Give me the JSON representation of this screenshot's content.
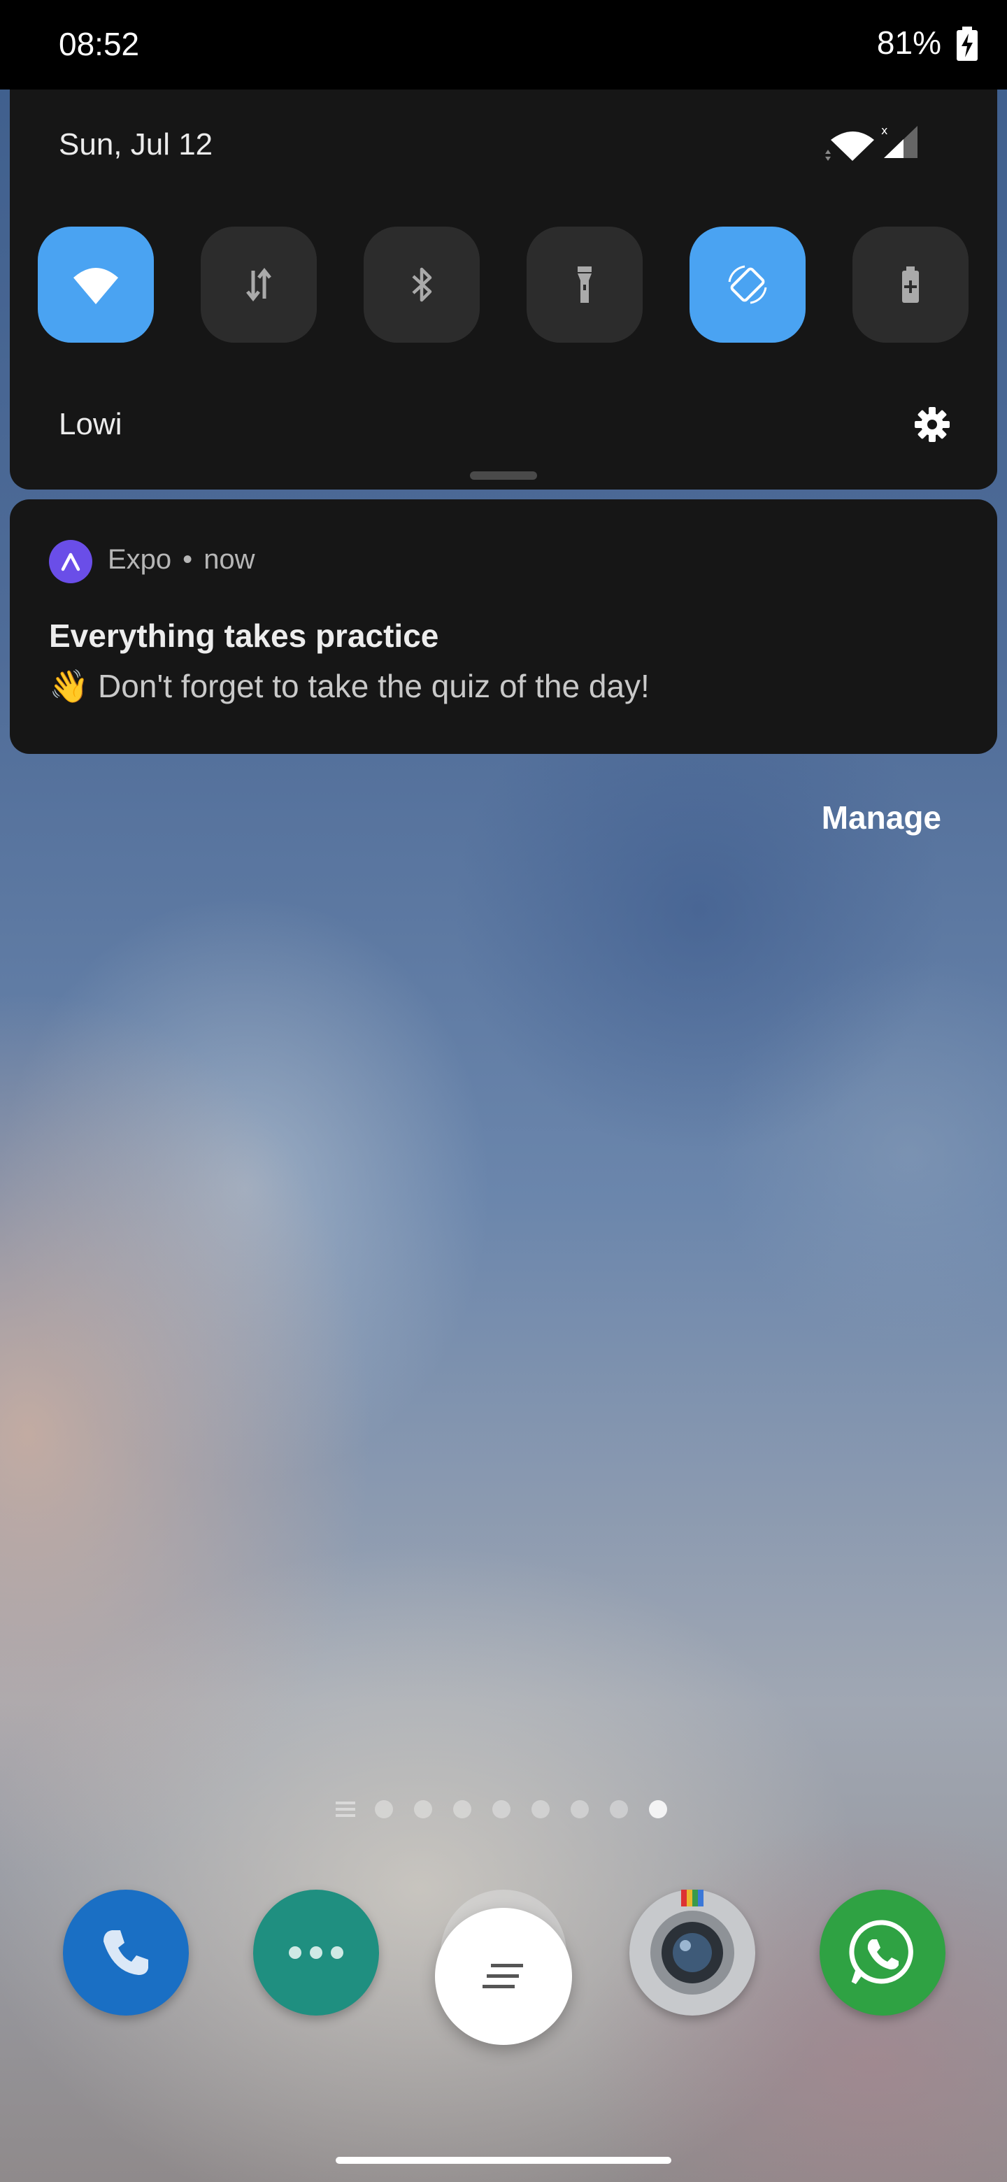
{
  "status_bar": {
    "time": "08:52",
    "battery": "81%"
  },
  "quick_settings": {
    "date": "Sun, Jul 12",
    "carrier": "Lowi",
    "tiles": [
      {
        "name": "wifi",
        "icon": "wifi-icon",
        "active": true
      },
      {
        "name": "mobile-data",
        "icon": "data-arrows-icon",
        "active": false
      },
      {
        "name": "bluetooth",
        "icon": "bluetooth-icon",
        "active": false
      },
      {
        "name": "flashlight",
        "icon": "flashlight-icon",
        "active": false
      },
      {
        "name": "auto-rotate",
        "icon": "rotate-icon",
        "active": true
      },
      {
        "name": "battery-saver",
        "icon": "battery-plus-icon",
        "active": false
      }
    ],
    "active_color": "#4aa3f2"
  },
  "notification": {
    "app_name": "Expo",
    "time": "now",
    "separator": "•",
    "title": "Everything takes practice",
    "body": "👋 Don't forget to take the quiz of the day!"
  },
  "manage_label": "Manage",
  "dock": [
    {
      "name": "phone",
      "icon": "phone-icon",
      "color": "#1a6fc4"
    },
    {
      "name": "messages",
      "icon": "dots-icon",
      "color": "#1f8f80"
    },
    {
      "name": "home",
      "icon": "home-lines-icon",
      "color": "#ffffff"
    },
    {
      "name": "camera",
      "icon": "camera-icon",
      "color": "#c7c9cc"
    },
    {
      "name": "whatsapp",
      "icon": "whatsapp-icon",
      "color": "#2fa243"
    }
  ]
}
